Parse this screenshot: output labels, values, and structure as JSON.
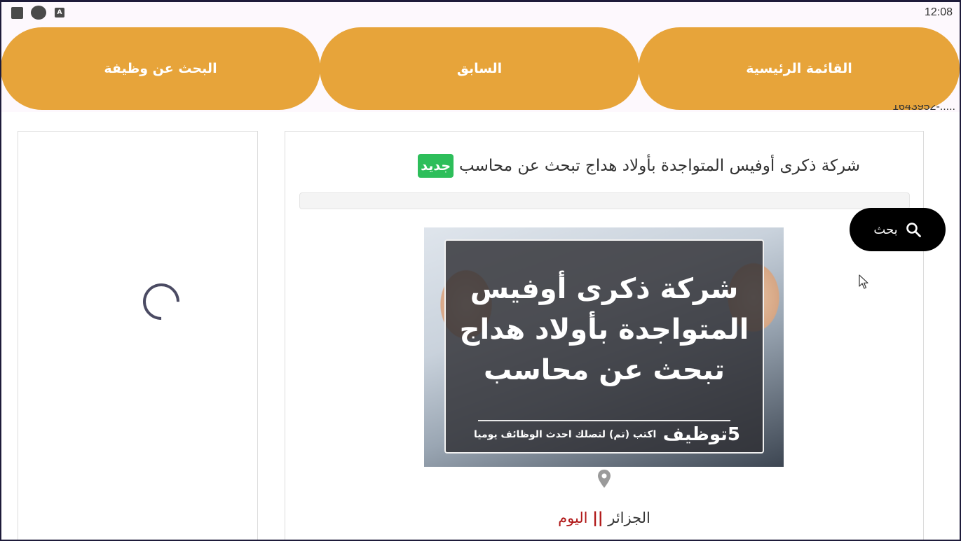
{
  "status_bar": {
    "time": "12:08",
    "icons": [
      "square-icon",
      "circle-icon",
      "a-icon"
    ],
    "a_icon_letter": "A"
  },
  "nav": {
    "home_label": "القائمة الرئيسية",
    "previous_label": "السابق",
    "job_search_label": "البحث عن وظيفة"
  },
  "clipped_text": "1643952-.....",
  "job": {
    "title": "شركة ذكرى أوفيس المتواجدة بأولاد هداج تبحث عن محاسب",
    "badge": "جديد",
    "image_title_line1": "شركة ذكرى أوفيس",
    "image_title_line2": "المتواجدة بأولاد هداج",
    "image_title_line3": "تبحث عن محاسب",
    "image_brand": "5توظيف",
    "image_slogan": "اكتب (تم) لتصلك احدث الوظائف يوميا",
    "country": "الجزائر",
    "separator": "||",
    "date": "اليوم"
  },
  "search_fab": {
    "label": "بحث"
  },
  "colors": {
    "nav_button": "#e7a43a",
    "badge_new": "#2dbe5a",
    "date_red": "#b01717",
    "fab": "#000000"
  }
}
